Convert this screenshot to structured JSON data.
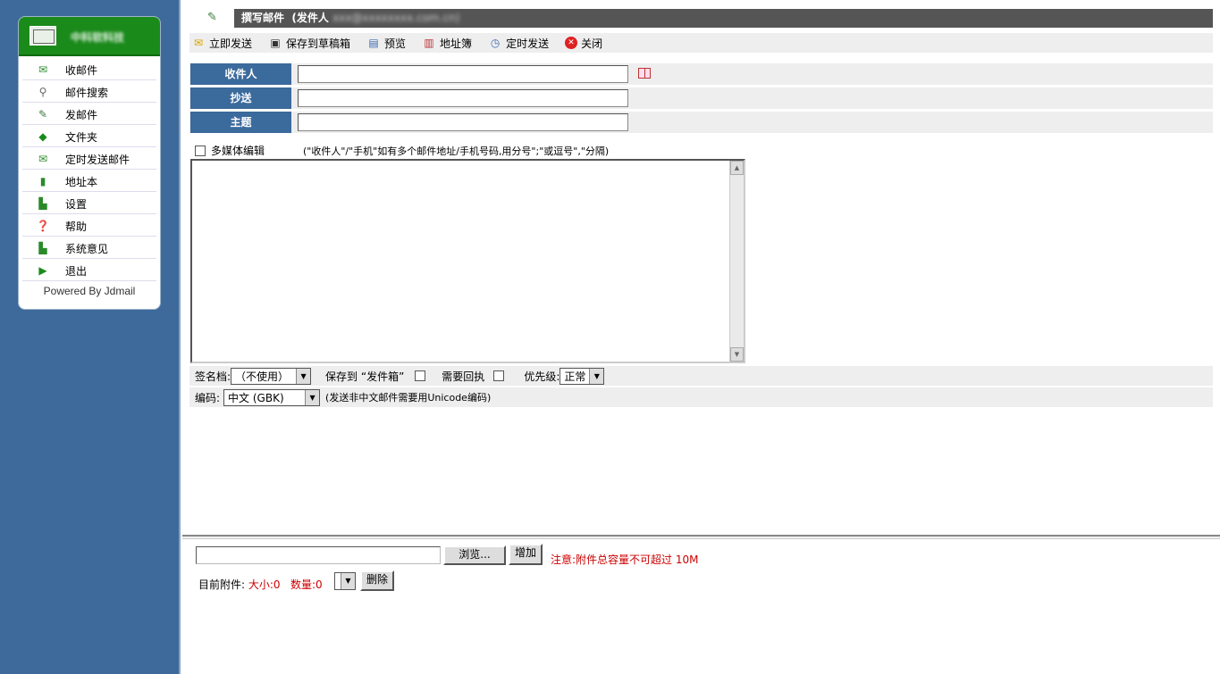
{
  "sidebar": {
    "logo_text": "中科软科技",
    "items": [
      {
        "label": "收邮件",
        "icon": "inbox-icon"
      },
      {
        "label": "邮件搜索",
        "icon": "search-icon"
      },
      {
        "label": "发邮件",
        "icon": "pen-icon"
      },
      {
        "label": "文件夹",
        "icon": "folder-icon"
      },
      {
        "label": "定时发送邮件",
        "icon": "clock-mail-icon"
      },
      {
        "label": "地址本",
        "icon": "address-book-icon"
      },
      {
        "label": "设置",
        "icon": "settings-icon"
      },
      {
        "label": "帮助",
        "icon": "help-icon"
      },
      {
        "label": "系统意见",
        "icon": "feedback-icon"
      },
      {
        "label": "退出",
        "icon": "exit-icon"
      }
    ],
    "powered": "Powered By Jdmail"
  },
  "header": {
    "title": "撰写邮件",
    "sender_label": "(发件人",
    "sender_value": "xxx@xxxxxxxx.com.cn)"
  },
  "toolbar": {
    "send_now": "立即发送",
    "save_draft": "保存到草稿箱",
    "preview": "预览",
    "address_book": "地址簿",
    "scheduled_send": "定时发送",
    "close": "关闭"
  },
  "form": {
    "to_label": "收件人",
    "to_value": "",
    "cc_label": "抄送",
    "cc_value": "",
    "subject_label": "主题",
    "subject_value": "",
    "multimedia_label": "多媒体编辑",
    "hint": "(\"收件人\"/\"手机\"如有多个邮件地址/手机号码,用分号\";\"或逗号\",\"分隔)"
  },
  "options": {
    "signature_label": "签名档:",
    "signature_value": "（不使用）",
    "save_to_label": "保存到 “发件箱”",
    "receipt_label": "需要回执",
    "priority_label": "优先级:",
    "priority_value": "正常",
    "encoding_label": "编码:",
    "encoding_value": "中文 (GBK)",
    "encoding_hint": "(发送非中文邮件需要用Unicode编码)"
  },
  "attachments": {
    "browse_label": "浏览...",
    "add_label": "增加",
    "limit_note": "注意:附件总容量不可超过  10M",
    "current_label": "目前附件:",
    "size_label": "大小:0",
    "count_label": "数量:0",
    "delete_label": "删除"
  },
  "colors": {
    "sidebar_bg": "#3d6a9a",
    "label_bg": "#3b6a9c",
    "header_bg": "#555555",
    "logo_green": "#1a8a1a",
    "warning_red": "#cc0000"
  }
}
